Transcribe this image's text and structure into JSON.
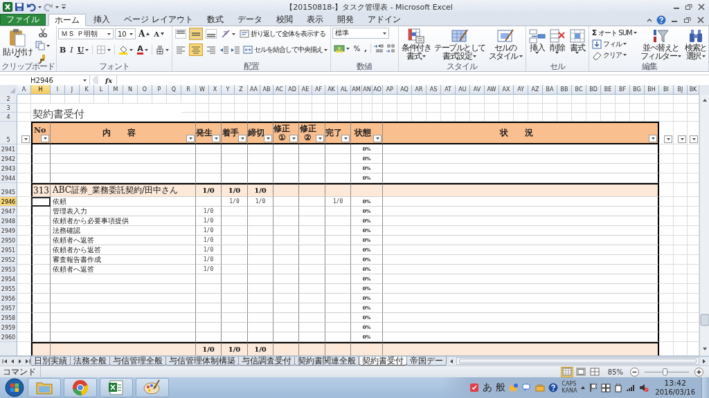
{
  "window": {
    "title": "【20150818-】タスク管理表 - Microsoft Excel"
  },
  "ribbon_tabs": [
    {
      "label": "ファイル",
      "kind": "file",
      "selected": false
    },
    {
      "label": "ホーム",
      "kind": "tab",
      "selected": true
    },
    {
      "label": "挿入",
      "kind": "tab",
      "selected": false
    },
    {
      "label": "ページ レイアウト",
      "kind": "tab",
      "selected": false
    },
    {
      "label": "数式",
      "kind": "tab",
      "selected": false
    },
    {
      "label": "データ",
      "kind": "tab",
      "selected": false
    },
    {
      "label": "校閲",
      "kind": "tab",
      "selected": false
    },
    {
      "label": "表示",
      "kind": "tab",
      "selected": false
    },
    {
      "label": "開発",
      "kind": "tab",
      "selected": false
    },
    {
      "label": "アドイン",
      "kind": "tab",
      "selected": false
    }
  ],
  "ribbon": {
    "clipboard": {
      "label": "クリップボード",
      "paste": "貼り付け"
    },
    "font": {
      "label": "フォント",
      "font_name": "ＭＳ Ｐ明朝",
      "font_size": "10",
      "grow": "A",
      "shrink": "A",
      "bold": "B",
      "italic": "I",
      "underline": "U",
      "font_color": "A"
    },
    "alignment": {
      "label": "配置",
      "vertical": [
        {
          "selected": false
        },
        {
          "selected": true
        },
        {
          "selected": false
        }
      ],
      "horizontal": [
        {
          "selected": false
        },
        {
          "selected": true
        },
        {
          "selected": false
        }
      ],
      "wrap_text": "折り返して全体を表示する",
      "merge_center": "セルを結合して中央揃え"
    },
    "number": {
      "label": "数値",
      "format": "標準",
      "percent": "%",
      "comma": ","
    },
    "styles": {
      "label": "スタイル",
      "buttons": [
        {
          "lines": [
            "条件付き",
            "書式"
          ]
        },
        {
          "lines": [
            "テーブルとして",
            "書式設定"
          ]
        },
        {
          "lines": [
            "セルの",
            "スタイル"
          ]
        }
      ]
    },
    "cells": {
      "label": "セル",
      "buttons": [
        "挿入",
        "削除",
        "書式"
      ]
    },
    "editing": {
      "label": "編集",
      "sum_symbol": "Σ",
      "auto_sum": "オート SUM",
      "fill": "フィル",
      "clear": "クリア",
      "sort_filter": [
        "並べ替えと",
        "フィルター"
      ],
      "find_select": [
        "検索と",
        "選択"
      ]
    }
  },
  "formula_bar": {
    "name_box": "H2946",
    "function_button": "fx"
  },
  "sheet": {
    "columns": [
      {
        "label": "A",
        "selected": false
      },
      {
        "label": "H",
        "selected": true
      },
      {
        "label": "I",
        "selected": false
      },
      {
        "label": "J",
        "selected": false
      },
      {
        "label": "K",
        "selected": false
      },
      {
        "label": "L",
        "selected": false
      },
      {
        "label": "M",
        "selected": false
      },
      {
        "label": "N",
        "selected": false
      },
      {
        "label": "O",
        "selected": false
      },
      {
        "label": "P",
        "selected": false
      },
      {
        "label": "Q",
        "selected": false
      },
      {
        "label": "R",
        "selected": false
      },
      {
        "label": "W",
        "selected": false
      },
      {
        "label": "X",
        "selected": false
      },
      {
        "label": "Y",
        "selected": false
      },
      {
        "label": "Z",
        "selected": false
      },
      {
        "label": "AA",
        "selected": false
      },
      {
        "label": "AB",
        "selected": false
      },
      {
        "label": "AC",
        "selected": false
      },
      {
        "label": "AD",
        "selected": false
      },
      {
        "label": "AE",
        "selected": false
      },
      {
        "label": "AF",
        "selected": false
      },
      {
        "label": "AK",
        "selected": false
      },
      {
        "label": "AL",
        "selected": false
      },
      {
        "label": "AM",
        "selected": false
      },
      {
        "label": "AN",
        "selected": false
      },
      {
        "label": "AO",
        "selected": false
      },
      {
        "label": "AP",
        "selected": false
      },
      {
        "label": "AQ",
        "selected": false
      },
      {
        "label": "AR",
        "selected": false
      },
      {
        "label": "AS",
        "selected": false
      },
      {
        "label": "AT",
        "selected": false
      },
      {
        "label": "AU",
        "selected": false
      },
      {
        "label": "AV",
        "selected": false
      },
      {
        "label": "AW",
        "selected": false
      },
      {
        "label": "AX",
        "selected": false
      },
      {
        "label": "AY",
        "selected": false
      },
      {
        "label": "AZ",
        "selected": false
      },
      {
        "label": "BA",
        "selected": false
      },
      {
        "label": "BB",
        "selected": false
      },
      {
        "label": "BC",
        "selected": false
      },
      {
        "label": "BD",
        "selected": false
      },
      {
        "label": "BE",
        "selected": false
      },
      {
        "label": "BF",
        "selected": false
      },
      {
        "label": "BG",
        "selected": false
      },
      {
        "label": "BH",
        "selected": false
      },
      {
        "label": "BI",
        "selected": false
      },
      {
        "label": "BJ",
        "selected": false
      },
      {
        "label": "BK",
        "selected": false
      }
    ],
    "top_rows": [
      "2",
      "3",
      "4"
    ],
    "title": "契約書受付",
    "header_row": {
      "row": "5",
      "labels": [
        "No",
        "内　　容",
        "発生",
        "着手",
        "締切",
        "修正\n①",
        "修正\n②",
        "完了",
        "状態",
        "状　　況"
      ]
    },
    "rows": [
      {
        "row": "2941",
        "selected": false,
        "kind": "task",
        "status": "0%"
      },
      {
        "row": "2942",
        "selected": false,
        "kind": "task",
        "status": "0%"
      },
      {
        "row": "2943",
        "selected": false,
        "kind": "task",
        "status": "0%"
      },
      {
        "row": "2944",
        "selected": false,
        "kind": "task",
        "status": "0%"
      },
      {
        "row": "2945",
        "selected": false,
        "kind": "group",
        "no": "313",
        "content": "ABC証券_業務委託契約/田中さん",
        "occurred": "1/0",
        "started": "1/0",
        "deadline": "1/0"
      },
      {
        "row": "2946",
        "selected": true,
        "kind": "task",
        "content": "依頼",
        "started": "1/0",
        "deadline": "1/0",
        "done": "1/0",
        "status": "0%"
      },
      {
        "row": "2947",
        "selected": false,
        "kind": "task",
        "content": "管理表入力",
        "occurred": "1/0",
        "status": "0%"
      },
      {
        "row": "2948",
        "selected": false,
        "kind": "task",
        "content": "依頼者から必要事項提供",
        "occurred": "1/0",
        "status": "0%"
      },
      {
        "row": "2949",
        "selected": false,
        "kind": "task",
        "content": "法務確認",
        "occurred": "1/0",
        "status": "0%"
      },
      {
        "row": "2950",
        "selected": false,
        "kind": "task",
        "content": "依頼者へ返答",
        "occurred": "1/0",
        "status": "0%"
      },
      {
        "row": "2951",
        "selected": false,
        "kind": "task",
        "content": "依頼者から返答",
        "occurred": "1/0",
        "status": "0%"
      },
      {
        "row": "2952",
        "selected": false,
        "kind": "task",
        "content": "審査報告書作成",
        "occurred": "1/0",
        "status": "0%"
      },
      {
        "row": "2953",
        "selected": false,
        "kind": "task",
        "content": "依頼者へ返答",
        "occurred": "1/0",
        "status": "0%"
      },
      {
        "row": "2954",
        "selected": false,
        "kind": "task",
        "status": "0%"
      },
      {
        "row": "2955",
        "selected": false,
        "kind": "task",
        "status": "0%"
      },
      {
        "row": "2956",
        "selected": false,
        "kind": "task",
        "status": "0%"
      },
      {
        "row": "2957",
        "selected": false,
        "kind": "task",
        "status": "0%"
      },
      {
        "row": "2958",
        "selected": false,
        "kind": "task",
        "status": "0%"
      },
      {
        "row": "2959",
        "selected": false,
        "kind": "task",
        "status": "0%"
      },
      {
        "row": "2960",
        "selected": false,
        "kind": "task",
        "status": "0%"
      },
      {
        "kind": "group",
        "occurred": "1/0",
        "started": "1/0",
        "deadline": "1/0"
      }
    ]
  },
  "sheet_tabs": [
    {
      "label": "日別実績",
      "selected": false
    },
    {
      "label": "法務全般",
      "selected": false
    },
    {
      "label": "与信管理全般",
      "selected": false
    },
    {
      "label": "与信管理体制構築",
      "selected": false
    },
    {
      "label": "与信調査受付",
      "selected": false
    },
    {
      "label": "契約書関連全般",
      "selected": false
    },
    {
      "label": "契約書受付",
      "selected": true
    },
    {
      "label": "帝国デー",
      "selected": false
    }
  ],
  "status_bar": {
    "mode": "コマンド",
    "views": [
      {
        "selected": true
      },
      {
        "selected": false
      },
      {
        "selected": false
      }
    ],
    "zoom": "85%",
    "zoom_slider": {
      "level": 0.45
    }
  },
  "taskbar": {
    "ime": [
      "あ",
      "般"
    ],
    "caps": "CAPS",
    "kana": "KANA",
    "time": "13:42",
    "date": "2016/03/16"
  }
}
